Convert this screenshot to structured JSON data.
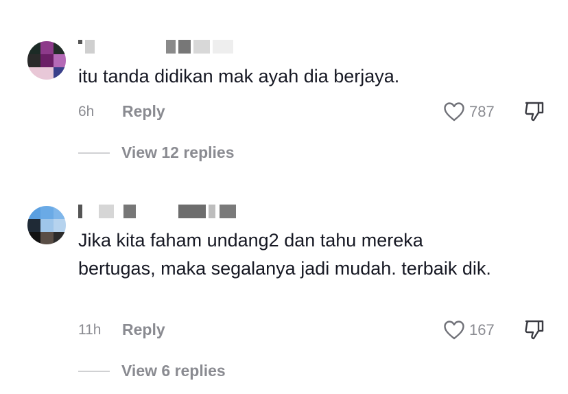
{
  "comments": [
    {
      "time": "6h",
      "text": "itu tanda didikan mak ayah dia berjaya.",
      "reply_label": "Reply",
      "likes": "787",
      "view_replies": "View 12 replies"
    },
    {
      "time": "11h",
      "text": "Jika kita faham undang2 dan tahu mereka bertugas, maka segalanya jadi mudah. terbaik dik.",
      "reply_label": "Reply",
      "likes": "167",
      "view_replies": "View 6 replies"
    }
  ],
  "icons": {
    "like": "heart-outline-icon",
    "dislike": "thumbs-down-outline-icon"
  },
  "colors": {
    "text": "#161823",
    "secondary": "#8a8b91",
    "divider": "#d0d1d3"
  }
}
